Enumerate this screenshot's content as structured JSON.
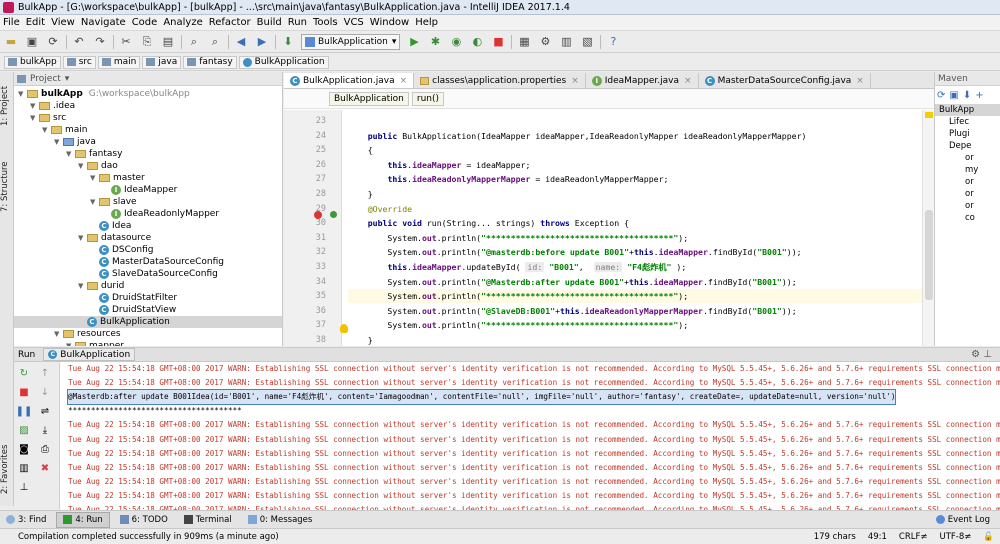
{
  "window": {
    "title": "BulkApp - [G:\\workspace\\bulkApp] - [bulkApp] - ...\\src\\main\\java\\fantasy\\BulkApplication.java - IntelliJ IDEA 2017.1.4"
  },
  "menu": [
    "File",
    "Edit",
    "View",
    "Navigate",
    "Code",
    "Analyze",
    "Refactor",
    "Build",
    "Run",
    "Tools",
    "VCS",
    "Window",
    "Help"
  ],
  "toolbar": {
    "run_config": "BulkApplication"
  },
  "navbar": [
    "bulkApp",
    "src",
    "main",
    "java",
    "fantasy",
    "BulkApplication"
  ],
  "side_tabs": {
    "project": "1: Project",
    "structure": "7: Structure",
    "favorites": "2: Favorites"
  },
  "project": {
    "header": "Project",
    "tree": [
      {
        "label": "bulkApp",
        "path": "G:\\workspace\\bulkApp",
        "icon": "module",
        "depth": 0
      },
      {
        "label": ".idea",
        "icon": "folder",
        "depth": 1
      },
      {
        "label": "src",
        "icon": "folder",
        "depth": 1
      },
      {
        "label": "main",
        "icon": "folder",
        "depth": 2
      },
      {
        "label": "java",
        "icon": "folder-src",
        "depth": 3
      },
      {
        "label": "fantasy",
        "icon": "folder",
        "depth": 4
      },
      {
        "label": "dao",
        "icon": "folder",
        "depth": 5
      },
      {
        "label": "master",
        "icon": "folder",
        "depth": 6
      },
      {
        "label": "IdeaMapper",
        "icon": "interface",
        "depth": 7
      },
      {
        "label": "slave",
        "icon": "folder",
        "depth": 6
      },
      {
        "label": "IdeaReadonlyMapper",
        "icon": "interface",
        "depth": 7
      },
      {
        "label": "Idea",
        "icon": "class",
        "depth": 6
      },
      {
        "label": "datasource",
        "icon": "folder",
        "depth": 5
      },
      {
        "label": "DSConfig",
        "icon": "class",
        "depth": 6
      },
      {
        "label": "MasterDataSourceConfig",
        "icon": "class",
        "depth": 6
      },
      {
        "label": "SlaveDataSourceConfig",
        "icon": "class",
        "depth": 6
      },
      {
        "label": "durid",
        "icon": "folder",
        "depth": 5
      },
      {
        "label": "DruidStatFilter",
        "icon": "class",
        "depth": 6
      },
      {
        "label": "DruidStatView",
        "icon": "class",
        "depth": 6
      },
      {
        "label": "BulkApplication",
        "icon": "class",
        "depth": 5
      },
      {
        "label": "resources",
        "icon": "folder",
        "depth": 3
      },
      {
        "label": "mapper",
        "icon": "folder",
        "depth": 4
      }
    ]
  },
  "editor": {
    "tabs": [
      "BulkApplication.java",
      "classes\\application.properties",
      "IdeaMapper.java",
      "MasterDataSourceConfig.java"
    ],
    "breadcrumb": [
      "BulkApplication",
      "run()"
    ],
    "line_numbers": [
      "23",
      "24",
      "25",
      "26",
      "27",
      "28",
      "29",
      "30",
      "31",
      "32",
      "33",
      "34",
      "35",
      "36",
      "37",
      "38"
    ],
    "lines": [
      "",
      "    public BulkApplication(IdeaMapper ideaMapper,IdeaReadonlyMapper ideaReadonlyMapperMapper)",
      "    {",
      "        this.ideaMapper = ideaMapper;",
      "        this.ideaReadonlyMapperMapper = ideaReadonlyMapperMapper;",
      "    }",
      "    @Override",
      "    public void run(String... strings) throws Exception {",
      "        System.out.println(\"**************************************\");",
      "        System.out.println(\"@masterdb:before update B001\"+this.ideaMapper.findById(\"B001\"));",
      "        this.ideaMapper.updateById( id: \"B001\",  name: \"F4彪炸机\" );",
      "        System.out.println(\"@Masterdb:after update B001\"+this.ideaMapper.findById(\"B001\"));",
      "        System.out.println(\"**************************************\");",
      "        System.out.println(\"@SlaveDB:B001\"+this.ideaReadonlyMapperMapper.findById(\"B001\"));",
      "        System.out.println(\"**************************************\");",
      "    }"
    ]
  },
  "maven": {
    "header": "Maven",
    "items": [
      "BulkApp",
      "Lifec",
      "Plugi",
      "Depe",
      "or",
      "my",
      "or",
      "or",
      "or",
      "co"
    ]
  },
  "run_panel": {
    "label": "Run",
    "tab": "BulkApplication",
    "console": [
      "Tue Aug 22 15:54:18 GMT+08:00 2017 WARN: Establishing SSL connection without server's identity verification is not recommended. According to MySQL 5.5.45+, 5.6.26+ and 5.7.6+ requirements SSL connection must",
      "Tue Aug 22 15:54:18 GMT+08:00 2017 WARN: Establishing SSL connection without server's identity verification is not recommended. According to MySQL 5.5.45+, 5.6.26+ and 5.7.6+ requirements SSL connection must",
      "@Masterdb:after update B001Idea(id='B001', name='F4彪炸机', content='Iamagoodman', contentFile='null', imgFile='null', author='fantasy', createDate=, updateDate=null, version='null')",
      "**************************************",
      "Tue Aug 22 15:54:18 GMT+08:00 2017 WARN: Establishing SSL connection without server's identity verification is not recommended. According to MySQL 5.5.45+, 5.6.26+ and 5.7.6+ requirements SSL connection must",
      "Tue Aug 22 15:54:18 GMT+08:00 2017 WARN: Establishing SSL connection without server's identity verification is not recommended. According to MySQL 5.5.45+, 5.6.26+ and 5.7.6+ requirements SSL connection must",
      "Tue Aug 22 15:54:18 GMT+08:00 2017 WARN: Establishing SSL connection without server's identity verification is not recommended. According to MySQL 5.5.45+, 5.6.26+ and 5.7.6+ requirements SSL connection must",
      "Tue Aug 22 15:54:18 GMT+08:00 2017 WARN: Establishing SSL connection without server's identity verification is not recommended. According to MySQL 5.5.45+, 5.6.26+ and 5.7.6+ requirements SSL connection must",
      "Tue Aug 22 15:54:18 GMT+08:00 2017 WARN: Establishing SSL connection without server's identity verification is not recommended. According to MySQL 5.5.45+, 5.6.26+ and 5.7.6+ requirements SSL connection must",
      "Tue Aug 22 15:54:18 GMT+08:00 2017 WARN: Establishing SSL connection without server's identity verification is not recommended. According to MySQL 5.5.45+, 5.6.26+ and 5.7.6+ requirements SSL connection must",
      "Tue Aug 22 15:54:18 GMT+08:00 2017 WARN: Establishing SSL connection without server's identity verification is not recommended. According to MySQL 5.5.45+, 5.6.26+ and 5.7.6+ requirements SSL connection must"
    ]
  },
  "bottom_tabs": [
    "3: Find",
    "4: Run",
    "6: TODO",
    "Terminal",
    "0: Messages"
  ],
  "event_log": "Event Log",
  "status": {
    "message": "Compilation completed successfully in 909ms (a minute ago)",
    "chars": "179 chars",
    "position": "49:1",
    "line_sep": "CRLF≠",
    "encoding": "UTF-8≠"
  }
}
